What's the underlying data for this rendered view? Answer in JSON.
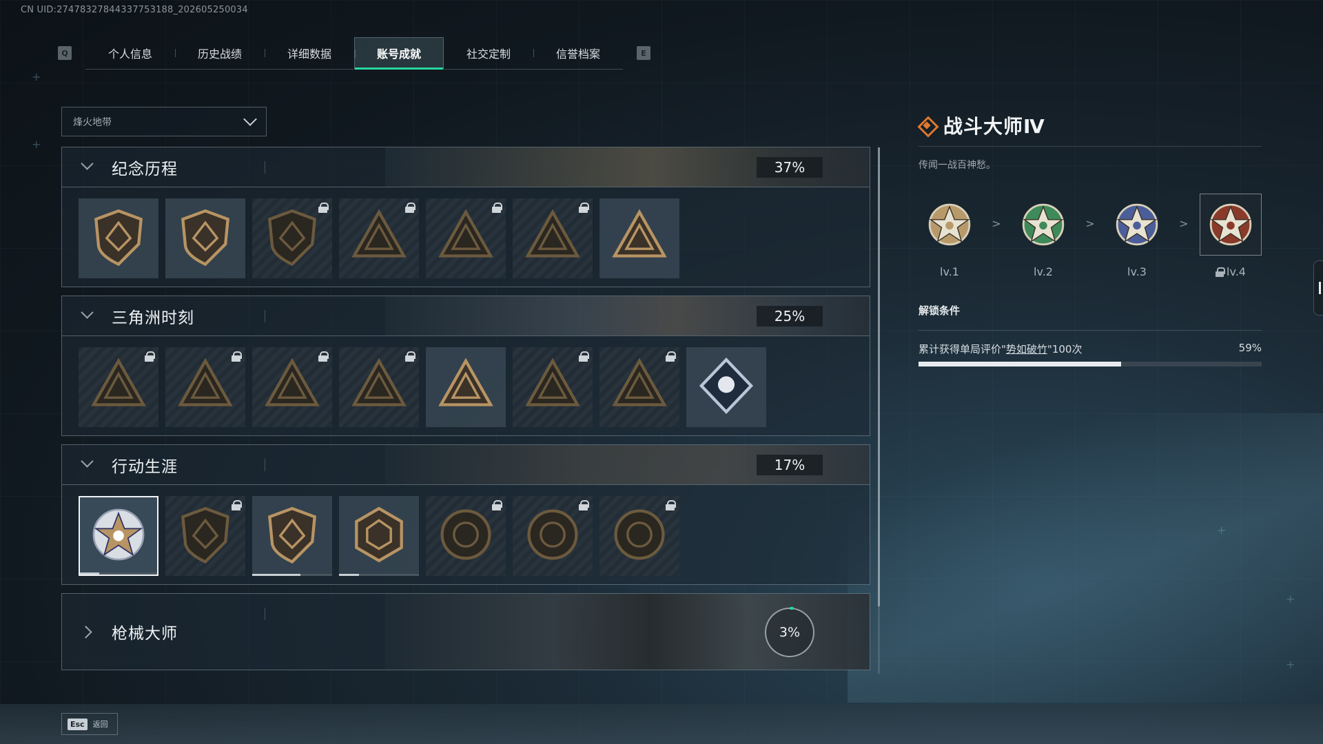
{
  "uid_text": "CN UID:27478327844337753188_202605250034",
  "nav": {
    "left_key": "Q",
    "right_key": "E",
    "tabs": [
      {
        "label": "个人信息"
      },
      {
        "label": "历史战绩"
      },
      {
        "label": "详细数据"
      },
      {
        "label": "账号成就",
        "active": true
      },
      {
        "label": "社交定制"
      },
      {
        "label": "信誉档案"
      }
    ]
  },
  "filter": {
    "selected": "烽火地带"
  },
  "categories": [
    {
      "title": "纪念历程",
      "percent": "37%",
      "badges": [
        {
          "icon": "triangle-shield-badge",
          "locked": false
        },
        {
          "icon": "helicopter-badge",
          "locked": false
        },
        {
          "icon": "gear-shield-badge",
          "locked": true
        },
        {
          "icon": "soldier-tower-badge",
          "locked": true
        },
        {
          "icon": "hooded-figure-badge",
          "locked": true
        },
        {
          "icon": "crossed-rifles-badge",
          "locked": true
        },
        {
          "icon": "number-one-badge",
          "locked": false
        }
      ]
    },
    {
      "title": "三角洲时刻",
      "percent": "25%",
      "badges": [
        {
          "icon": "bottle-triangle-badge",
          "locked": true
        },
        {
          "icon": "armor-triangle-badge",
          "locked": true
        },
        {
          "icon": "seated-figure-badge",
          "locked": true
        },
        {
          "icon": "hands-triangle-badge",
          "locked": true
        },
        {
          "icon": "gold-squad-badge",
          "locked": false
        },
        {
          "icon": "squad-triangle-badge",
          "locked": true
        },
        {
          "icon": "fish-triangle-badge",
          "locked": true
        },
        {
          "icon": "rose-diamond-badge",
          "locked": false
        }
      ]
    },
    {
      "title": "行动生涯",
      "percent": "17%",
      "badges": [
        {
          "icon": "star-eagle-badge",
          "locked": false,
          "selected": true,
          "progress": 0.25
        },
        {
          "icon": "chevron-shield-badge",
          "locked": true
        },
        {
          "icon": "split-shield-badge",
          "locked": false,
          "progress": 0.6
        },
        {
          "icon": "gem-shield-badge",
          "locked": false,
          "progress": 0.25
        },
        {
          "icon": "ring-badge",
          "locked": true
        },
        {
          "icon": "skull-wing-badge",
          "locked": true
        },
        {
          "icon": "eye-wing-badge",
          "locked": true
        }
      ]
    },
    {
      "title": "枪械大师",
      "percent": "3%",
      "collapsed": true
    }
  ],
  "detail": {
    "title": "战斗大师Ⅳ",
    "description": "传闻一战百神愁。",
    "levels": [
      {
        "label": "lv.1",
        "color": "#b89a6a"
      },
      {
        "label": "lv.2",
        "color": "#3f8a5a"
      },
      {
        "label": "lv.3",
        "color": "#4b5e9a"
      },
      {
        "label": "lv.4",
        "color": "#8a3a2a",
        "locked": true,
        "current": true
      }
    ],
    "separator": ">",
    "unlock_heading": "解锁条件",
    "condition_prefix": "累计获得单局评价\"",
    "condition_highlight": "势如破竹",
    "condition_suffix": "\"100次",
    "progress_text": "59%",
    "progress": 0.59
  },
  "footer": {
    "esc_key": "Esc",
    "esc_label": "返回"
  }
}
